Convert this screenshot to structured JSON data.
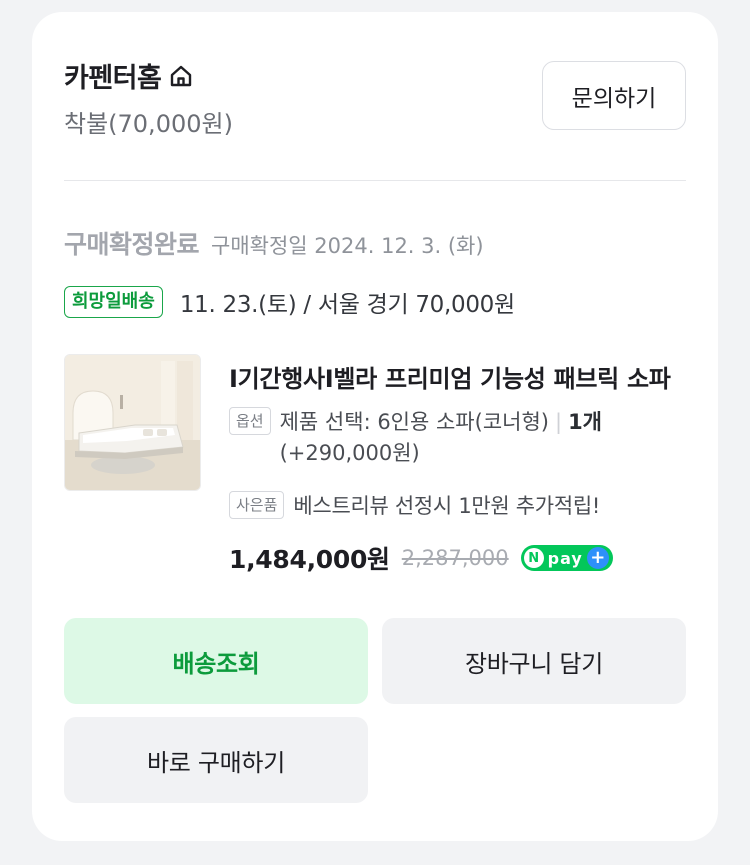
{
  "seller": {
    "name": "카펜터홈",
    "shipping_fee": "착불(70,000원)",
    "inquiry_label": "문의하기"
  },
  "order_status": {
    "title": "구매확정완료",
    "confirm_date": "구매확정일 2024. 12. 3. (화)"
  },
  "delivery": {
    "badge": "희망일배송",
    "text": "11. 23.(토) / 서울 경기 70,000원"
  },
  "product": {
    "title": "I기간행사I벨라 프리미엄 기능성 패브릭 소파",
    "option_tag": "옵션",
    "option_text": "제품 선택: 6인용 소파(코너형)",
    "option_qty": "1개",
    "option_extra": "(+290,000원)",
    "gift_tag": "사은품",
    "gift_text": "베스트리뷰 선정시 1만원 추가적립!",
    "price": "1,484,000원",
    "original_price": "2,287,000",
    "npay_n": "N",
    "npay_text": "pay",
    "npay_plus": "+"
  },
  "actions": {
    "track_label": "배송조회",
    "cart_label": "장바구니 담기",
    "buy_label": "바로 구매하기"
  },
  "colors": {
    "accent_green": "#0c9b3c",
    "track_bg": "#ddf9e6",
    "npay_green": "#03c75a"
  }
}
